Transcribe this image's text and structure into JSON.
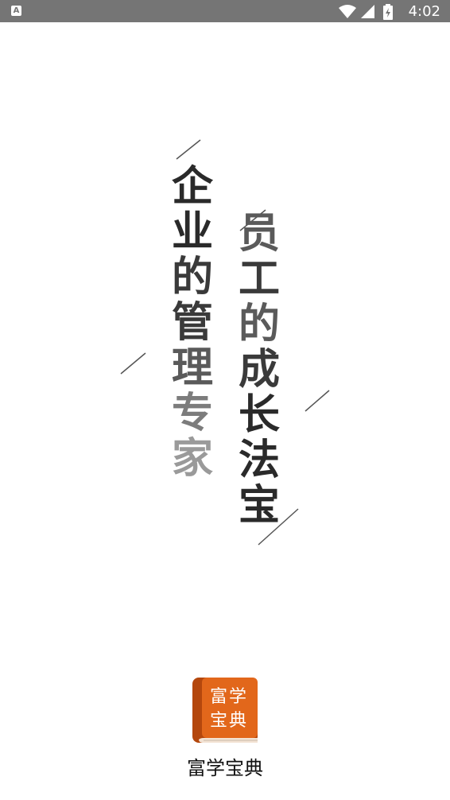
{
  "status_bar": {
    "time": "4:02",
    "notification_icon": "A"
  },
  "splash": {
    "column_left": [
      "企",
      "业",
      "的",
      "管",
      "理",
      "专",
      "家"
    ],
    "column_right": [
      "员",
      "工",
      "的",
      "成",
      "长",
      "法",
      "宝"
    ]
  },
  "app": {
    "logo_line1": "富学",
    "logo_line2": "宝典",
    "name": "富学宝典",
    "logo_color": "#e2671b",
    "logo_spine_color": "#b4470d"
  }
}
